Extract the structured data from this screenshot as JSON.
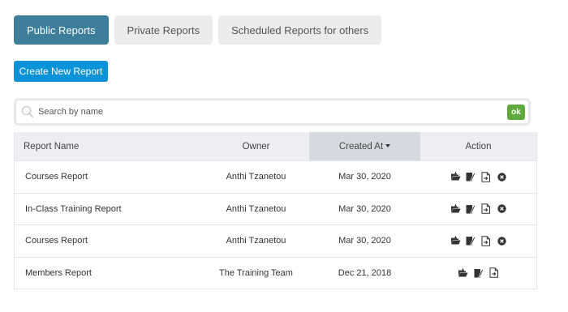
{
  "tabs": [
    {
      "label": "Public Reports",
      "active": true
    },
    {
      "label": "Private Reports",
      "active": false
    },
    {
      "label": "Scheduled Reports for others",
      "active": false
    }
  ],
  "create_button": {
    "label": "Create New Report"
  },
  "search": {
    "placeholder": "Search by name",
    "value": "",
    "ok_label": "ok"
  },
  "table": {
    "columns": {
      "name": "Report Name",
      "owner": "Owner",
      "created": "Created At",
      "action": "Action"
    },
    "sorted_column": "created",
    "rows": [
      {
        "name": "Courses Report",
        "owner": "Anthi Tzanetou",
        "created": "Mar 30, 2020",
        "deletable": true
      },
      {
        "name": "In-Class Training Report",
        "owner": "Anthi Tzanetou",
        "created": "Mar 30, 2020",
        "deletable": true
      },
      {
        "name": "Courses Report",
        "owner": "Anthi Tzanetou",
        "created": "Mar 30, 2020",
        "deletable": true
      },
      {
        "name": "Members Report",
        "owner": "The Training Team",
        "created": "Dec 21, 2018",
        "deletable": false
      }
    ],
    "row_action_icons": [
      "open-folder-icon",
      "edit-icon",
      "export-icon",
      "delete-icon"
    ]
  },
  "colors": {
    "tab_active": "#3d7e9a",
    "primary_button": "#0a93d6",
    "ok_button": "#5fa93d",
    "header_bg": "#eceef1",
    "sorted_header_bg": "#d6d9e0"
  }
}
